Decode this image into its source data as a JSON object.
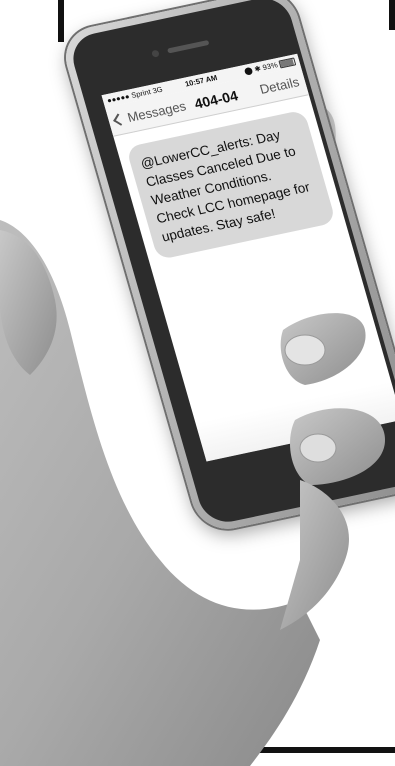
{
  "status_bar": {
    "carrier": "●●●●● Sprint  3G",
    "time": "10:57 AM",
    "battery": "⬤ ✱ 93%"
  },
  "nav": {
    "back_label": "Messages",
    "title": "404-04",
    "details_label": "Details"
  },
  "message": {
    "text": "@LowerCC_alerts: Day Classes Canceled Due to Weather Conditions. Check LCC homepage for updates. Stay safe!"
  },
  "icons": {
    "back": "chevron-left-icon",
    "battery": "battery-icon"
  },
  "colors": {
    "bubble": "#d8d8d8",
    "nav_bar": "#f4f4f4",
    "phone_frame": "#b9b9b9"
  }
}
